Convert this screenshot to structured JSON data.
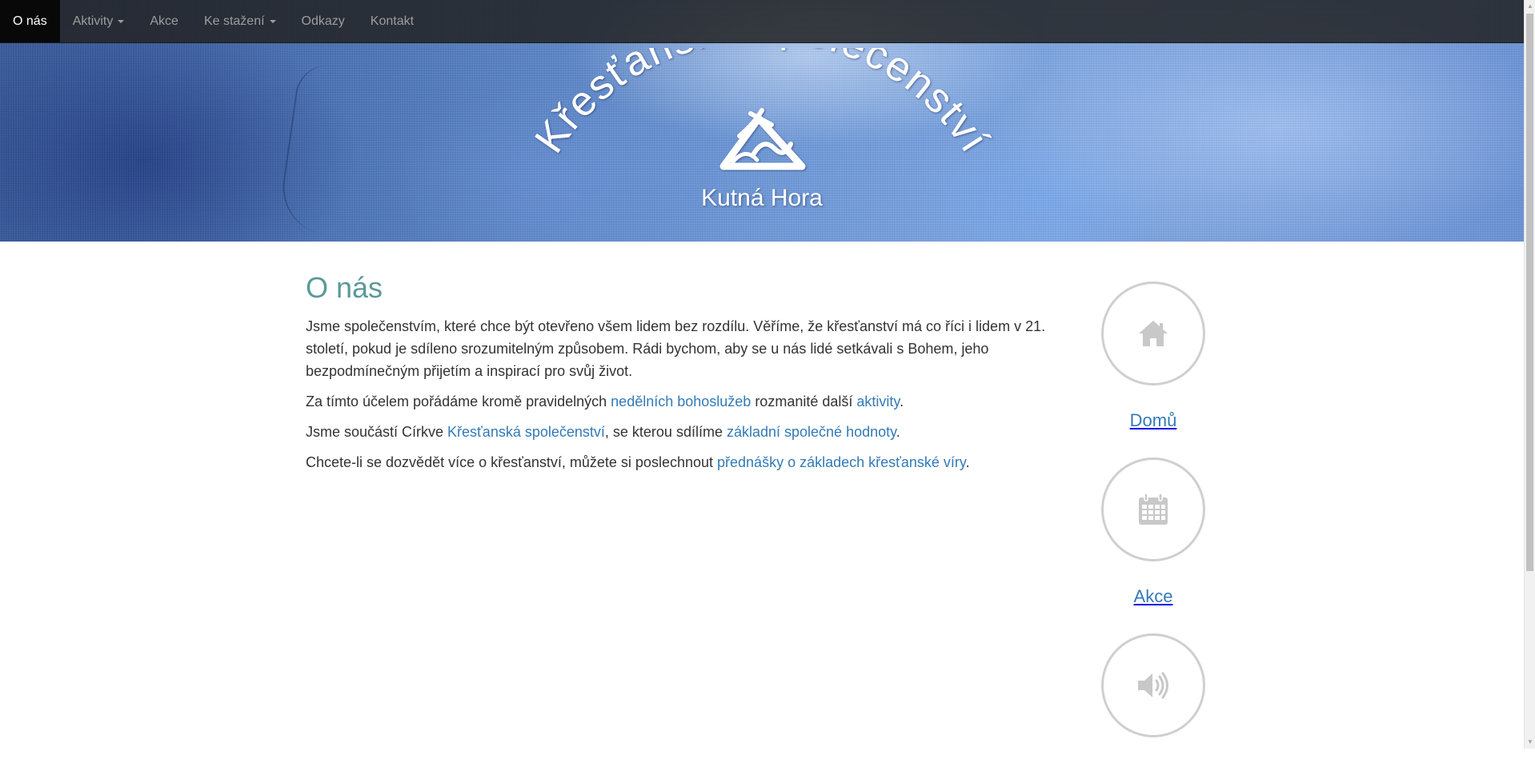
{
  "navbar": {
    "items": [
      {
        "label": "O nás",
        "active": true,
        "dropdown": false
      },
      {
        "label": "Aktivity",
        "active": false,
        "dropdown": true
      },
      {
        "label": "Akce",
        "active": false,
        "dropdown": false
      },
      {
        "label": "Ke stažení",
        "active": false,
        "dropdown": true
      },
      {
        "label": "Odkazy",
        "active": false,
        "dropdown": false
      },
      {
        "label": "Kontakt",
        "active": false,
        "dropdown": false
      }
    ]
  },
  "banner": {
    "logo_arc_text": "Křesťanské společenství",
    "logo_subtitle": "Kutná Hora"
  },
  "main": {
    "title": "O nás",
    "p1": "Jsme společenstvím, které chce být otevřeno všem lidem bez rozdílu. Věříme, že křesťanství má co říci i lidem v 21. století, pokud je sdíleno srozumitelným způsobem.  Rádi bychom, aby se u nás lidé setkávali s Bohem, jeho bezpodmínečným přijetím a inspirací pro svůj život.",
    "p2": {
      "before": "Za tímto účelem pořádáme kromě pravidelných ",
      "link1": "nedělních bohoslužeb",
      "middle": " rozmanité další ",
      "link2": "aktivity",
      "after": "."
    },
    "p3": {
      "before": "Jsme součástí Církve ",
      "link1": "Křesťanská společenství",
      "middle": ", se kterou sdílíme ",
      "link2": "základní společné hodnoty",
      "after": "."
    },
    "p4": {
      "before": "Chcete-li se dozvědět více o křesťanství, můžete si poslechnout ",
      "link1": "přednášky o základech křesťanské víry",
      "after": "."
    }
  },
  "sidebar": {
    "items": [
      {
        "label": "Domů",
        "icon": "home-icon"
      },
      {
        "label": "Akce",
        "icon": "calendar-icon"
      },
      {
        "label": "",
        "icon": "speaker-icon"
      }
    ]
  },
  "colors": {
    "navbar_bg": "#222222",
    "nav_active_bg": "#080808",
    "heading": "#5a9a96",
    "link": "#337ab7",
    "circle_border": "#cfcfcf",
    "icon": "#c8c8c8"
  }
}
